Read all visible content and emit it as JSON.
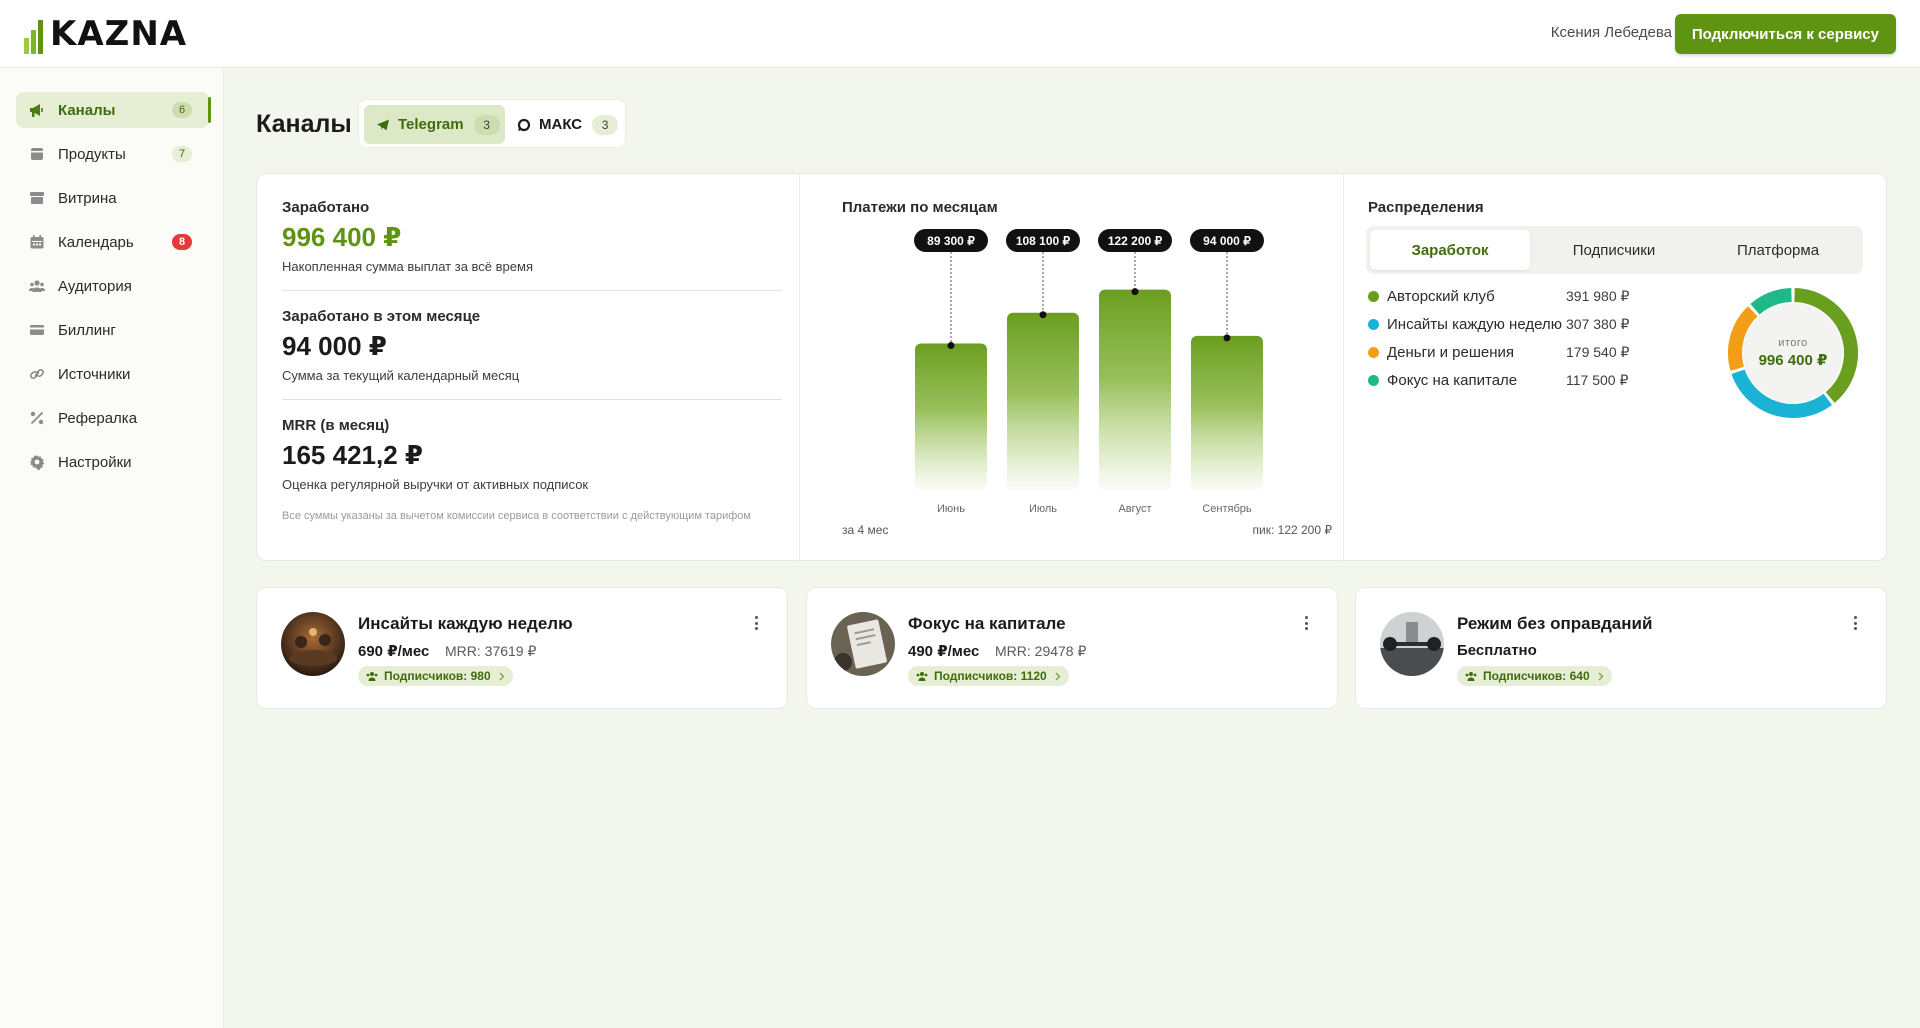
{
  "header": {
    "logo_text": "KAZNA",
    "user_name": "Ксения Лебедева",
    "connect_label": "Подключиться к сервису"
  },
  "sidebar": {
    "items": [
      {
        "label": "Каналы",
        "icon": "megaphone-icon",
        "badge": "6",
        "active": true
      },
      {
        "label": "Продукты",
        "icon": "box-icon",
        "badge": "7"
      },
      {
        "label": "Витрина",
        "icon": "storefront-icon"
      },
      {
        "label": "Календарь",
        "icon": "calendar-icon",
        "badge": "8",
        "badge_color": "red"
      },
      {
        "label": "Аудитория",
        "icon": "users-icon"
      },
      {
        "label": "Биллинг",
        "icon": "credit-card-icon"
      },
      {
        "label": "Источники",
        "icon": "link-icon"
      },
      {
        "label": "Рефералка",
        "icon": "percent-icon"
      },
      {
        "label": "Настройки",
        "icon": "gear-icon"
      }
    ]
  },
  "page": {
    "title": "Каналы",
    "platform_tabs": [
      {
        "label": "Telegram",
        "count": "3",
        "icon": "telegram-icon",
        "active": true
      },
      {
        "label": "МАКС",
        "count": "3",
        "icon": "max-icon"
      }
    ]
  },
  "stats": {
    "earned": {
      "label": "Заработано",
      "value": "996 400 ₽",
      "sub": "Накопленная сумма выплат за всё время"
    },
    "month": {
      "label": "Заработано в этом месяце",
      "value": "94 000 ₽",
      "sub": "Сумма за текущий календарный месяц"
    },
    "mrr": {
      "label": "MRR (в месяц)",
      "value": "165 421,2 ₽",
      "sub": "Оценка регулярной выручки от активных подписок"
    },
    "note": "Все суммы указаны за вычетом комиссии сервиса в соответствии с действующим тарифом"
  },
  "payments": {
    "title": "Платежи по месяцам",
    "period": "за 4 мес",
    "peak": "пик: 122 200 ₽"
  },
  "chart_data": {
    "type": "bar",
    "title": "Платежи по месяцам",
    "categories": [
      "Июнь",
      "Июль",
      "Август",
      "Сентябрь"
    ],
    "values": [
      89300,
      108100,
      122200,
      94000
    ],
    "value_labels": [
      "89 300 ₽",
      "108 100 ₽",
      "122 200 ₽",
      "94 000 ₽"
    ],
    "color": "#6a9e1f",
    "grid": false
  },
  "distribution": {
    "title": "Распределения",
    "tabs": [
      "Заработок",
      "Подписчики",
      "Платформа"
    ],
    "active_tab": "Заработок",
    "items": [
      {
        "name": "Авторский клуб",
        "value": "391 980 ₽",
        "amount": 391980,
        "color": "#6a9e1f"
      },
      {
        "name": "Инсайты каждую неделю",
        "value": "307 380 ₽",
        "amount": 307380,
        "color": "#1ab3d6"
      },
      {
        "name": "Деньги и решения",
        "value": "179 540 ₽",
        "amount": 179540,
        "color": "#f29f17"
      },
      {
        "name": "Фокус на капитале",
        "value": "117 500 ₽",
        "amount": 117500,
        "color": "#1fb989"
      }
    ],
    "total_label": "итого",
    "total_value": "996 400 ₽"
  },
  "channels": [
    {
      "name": "Инсайты каждую неделю",
      "price": "690 ₽/мес",
      "mrr": "MRR: 37619 ₽",
      "subscribers": "Подписчиков: 980"
    },
    {
      "name": "Фокус на капитале",
      "price": "490 ₽/мес",
      "mrr": "MRR: 29478 ₽",
      "subscribers": "Подписчиков: 1120"
    },
    {
      "name": "Режим без оправданий",
      "price": "Бесплатно",
      "mrr": "",
      "subscribers": "Подписчиков: 640"
    }
  ]
}
